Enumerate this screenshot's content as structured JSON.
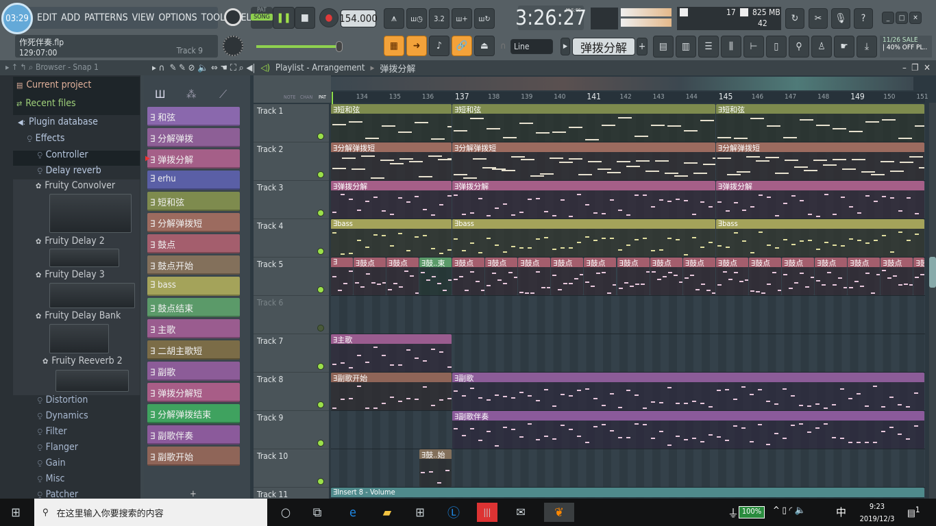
{
  "topbar": {
    "clock_badge": "03:29",
    "menu": [
      "EDIT",
      "ADD",
      "PATTERNS",
      "VIEW",
      "OPTIONS",
      "TOOLS",
      "HELP"
    ],
    "file_name": "作死伴奏.flp",
    "position": "129:07:00",
    "hint_target": "Track 9",
    "pat_label": "PAT",
    "song_label": "SONG",
    "mode": "SONG",
    "tempo": "154.000",
    "time": "3:26:27",
    "time_format": "M:S:CS",
    "cpu": "17",
    "memory": "825 MB",
    "polyphony": "42",
    "snap": "Line",
    "pattern_selector": "弹拨分解",
    "news": "11/26  SALE",
    "news2": "| 40% OFF PL.."
  },
  "browser": {
    "header": "Browser - Snap 1",
    "items": [
      {
        "label": "Current project",
        "icon": "file-icon"
      },
      {
        "label": "Recent files",
        "icon": "recent-icon"
      },
      {
        "label": "Plugin database",
        "icon": "speaker-icon"
      },
      {
        "label": "Effects",
        "icon": "plug-icon"
      },
      {
        "label": "Controller",
        "icon": "plug-icon"
      },
      {
        "label": "Delay reverb",
        "icon": "plug-icon"
      },
      {
        "label": "Fruity Convolver",
        "icon": "gear-icon"
      },
      {
        "label": "Fruity Delay 2",
        "icon": "gear-icon"
      },
      {
        "label": "Fruity Delay 3",
        "icon": "gear-icon"
      },
      {
        "label": "Fruity Delay Bank",
        "icon": "gear-icon"
      },
      {
        "label": "Fruity Reeverb 2",
        "icon": "gear-icon"
      },
      {
        "label": "Distortion",
        "icon": "plug-icon"
      },
      {
        "label": "Dynamics",
        "icon": "plug-icon"
      },
      {
        "label": "Filter",
        "icon": "plug-icon"
      },
      {
        "label": "Flanger",
        "icon": "plug-icon"
      },
      {
        "label": "Gain",
        "icon": "plug-icon"
      },
      {
        "label": "Misc",
        "icon": "plug-icon"
      },
      {
        "label": "Patcher",
        "icon": "plug-icon"
      }
    ]
  },
  "patterns": [
    {
      "label": "和弦",
      "color": "#8a68ad"
    },
    {
      "label": "分解弹拨",
      "color": "#8d5f96"
    },
    {
      "label": "弹拨分解",
      "color": "#a55f88",
      "selected": true
    },
    {
      "label": "erhu",
      "color": "#5a5fa6"
    },
    {
      "label": "短和弦",
      "color": "#7e8b4e"
    },
    {
      "label": "分解弹拨短",
      "color": "#9c6b5f"
    },
    {
      "label": "鼓点",
      "color": "#a45e6d"
    },
    {
      "label": "鼓点开始",
      "color": "#83705b"
    },
    {
      "label": "bass",
      "color": "#a4a35a"
    },
    {
      "label": "鼓点结束",
      "color": "#5b9a69"
    },
    {
      "label": "主歌",
      "color": "#9a5c8f"
    },
    {
      "label": "二胡主歌短",
      "color": "#7b6c47"
    },
    {
      "label": "副歌",
      "color": "#8c5c98"
    },
    {
      "label": "弹拨分解短",
      "color": "#a85d87"
    },
    {
      "label": "分解弹拨结束",
      "color": "#3fa25f"
    },
    {
      "label": "副歌伴奏",
      "color": "#8b5a9b"
    },
    {
      "label": "副歌开始",
      "color": "#8f6558"
    }
  ],
  "playlist": {
    "title": "Playlist - Arrangement",
    "current_pattern": "弹拨分解",
    "tabs": [
      "NOTE",
      "CHAN",
      "PAT"
    ],
    "ruler": [
      "134",
      "135",
      "136",
      "137",
      "138",
      "139",
      "140",
      "141",
      "142",
      "143",
      "144",
      "145",
      "146",
      "147",
      "148",
      "149",
      "150",
      "151"
    ],
    "tracks": [
      {
        "name": "Track 1",
        "clips": [
          {
            "label": "短和弦",
            "start": 133,
            "end": 137,
            "color": "#7e8b4e"
          },
          {
            "label": "短和弦",
            "start": 137,
            "end": 145,
            "color": "#7e8b4e"
          },
          {
            "label": "短和弦",
            "start": 145,
            "end": 153,
            "color": "#7e8b4e"
          }
        ]
      },
      {
        "name": "Track 2",
        "clips": [
          {
            "label": "分解弹拨短",
            "start": 133,
            "end": 137,
            "color": "#9c6b5f"
          },
          {
            "label": "分解弹拨短",
            "start": 137,
            "end": 145,
            "color": "#9c6b5f"
          },
          {
            "label": "分解弹拨短",
            "start": 145,
            "end": 153,
            "color": "#9c6b5f"
          }
        ]
      },
      {
        "name": "Track 3",
        "clips": [
          {
            "label": "弹拨分解",
            "start": 133,
            "end": 137,
            "color": "#a55f88"
          },
          {
            "label": "弹拨分解",
            "start": 137,
            "end": 145,
            "color": "#a55f88"
          },
          {
            "label": "弹拨分解",
            "start": 145,
            "end": 153,
            "color": "#a55f88"
          }
        ]
      },
      {
        "name": "Track 4",
        "clips": [
          {
            "label": "bass",
            "start": 133,
            "end": 137,
            "color": "#a4a35a"
          },
          {
            "label": "bass",
            "start": 137,
            "end": 145,
            "color": "#a4a35a"
          },
          {
            "label": "bass",
            "start": 145,
            "end": 153,
            "color": "#a4a35a"
          }
        ]
      },
      {
        "name": "Track 5",
        "clips": [
          {
            "label": "",
            "start": 133,
            "end": 134,
            "color": "#a45e6d"
          },
          {
            "label": "鼓点",
            "start": 134,
            "end": 135,
            "color": "#a45e6d"
          },
          {
            "label": "鼓点",
            "start": 135,
            "end": 136,
            "color": "#a45e6d"
          },
          {
            "label": "鼓..束",
            "start": 136,
            "end": 137,
            "color": "#5b9a69"
          },
          {
            "label": "鼓点",
            "start": 137,
            "end": 138,
            "color": "#a45e6d"
          },
          {
            "label": "鼓点",
            "start": 138,
            "end": 139,
            "color": "#a45e6d"
          },
          {
            "label": "鼓点",
            "start": 139,
            "end": 140,
            "color": "#a45e6d"
          },
          {
            "label": "鼓点",
            "start": 140,
            "end": 141,
            "color": "#a45e6d"
          },
          {
            "label": "鼓点",
            "start": 141,
            "end": 142,
            "color": "#a45e6d"
          },
          {
            "label": "鼓点",
            "start": 142,
            "end": 143,
            "color": "#a45e6d"
          },
          {
            "label": "鼓点",
            "start": 143,
            "end": 144,
            "color": "#a45e6d"
          },
          {
            "label": "鼓点",
            "start": 144,
            "end": 145,
            "color": "#a45e6d"
          },
          {
            "label": "鼓点",
            "start": 145,
            "end": 146,
            "color": "#a45e6d"
          },
          {
            "label": "鼓点",
            "start": 146,
            "end": 147,
            "color": "#a45e6d"
          },
          {
            "label": "鼓点",
            "start": 147,
            "end": 148,
            "color": "#a45e6d"
          },
          {
            "label": "鼓点",
            "start": 148,
            "end": 149,
            "color": "#a45e6d"
          },
          {
            "label": "鼓点",
            "start": 149,
            "end": 150,
            "color": "#a45e6d"
          },
          {
            "label": "鼓点",
            "start": 150,
            "end": 151,
            "color": "#a45e6d"
          },
          {
            "label": "鼓点",
            "start": 151,
            "end": 152,
            "color": "#a45e6d"
          }
        ]
      },
      {
        "name": "Track 6",
        "muted": true,
        "clips": []
      },
      {
        "name": "Track 7",
        "clips": [
          {
            "label": "主歌",
            "start": 133,
            "end": 137,
            "color": "#9a5c8f"
          }
        ]
      },
      {
        "name": "Track 8",
        "clips": [
          {
            "label": "副歌开始",
            "start": 133,
            "end": 137,
            "color": "#8f6558"
          },
          {
            "label": "副歌",
            "start": 137,
            "end": 153,
            "color": "#8c5c98"
          }
        ]
      },
      {
        "name": "Track 9",
        "clips": [
          {
            "label": "副歌伴奏",
            "start": 137,
            "end": 153,
            "color": "#8b5a9b"
          }
        ]
      },
      {
        "name": "Track 10",
        "clips": [
          {
            "label": "鼓..始",
            "start": 136,
            "end": 137,
            "color": "#83705b"
          }
        ]
      },
      {
        "name": "Track 11",
        "clips": [
          {
            "label": "Insert 8 - Volume",
            "start": 133,
            "end": 153,
            "color": "#4f8a8c"
          }
        ]
      }
    ]
  },
  "taskbar": {
    "search_placeholder": "在这里输入你要搜索的内容",
    "battery": "100%",
    "ime": "中",
    "time": "9:23",
    "date": "2019/12/3",
    "notifications": "1"
  }
}
